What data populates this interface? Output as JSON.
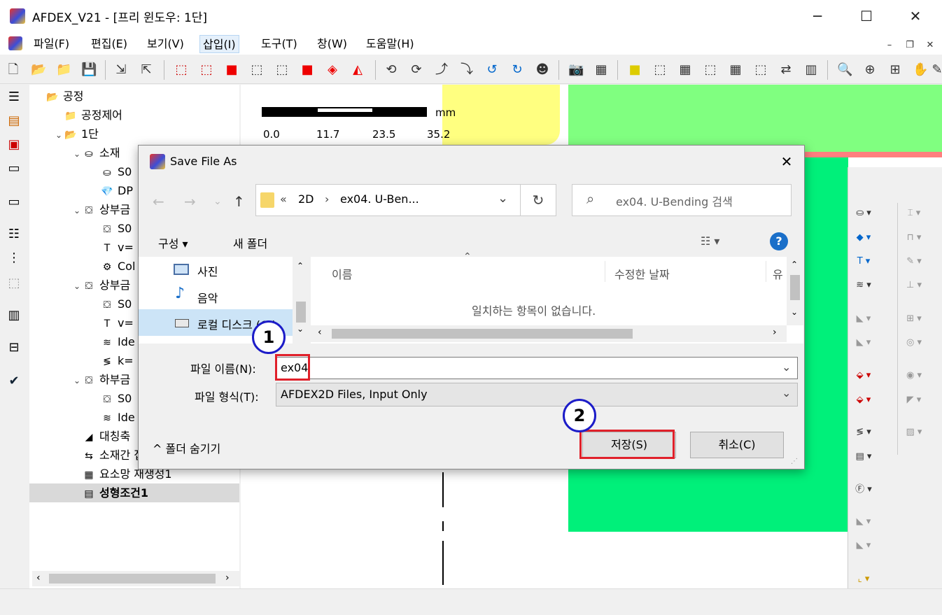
{
  "window": {
    "title": "AFDEX_V21 - [프리 윈도우: 1단]",
    "minimize": "─",
    "maximize": "☐",
    "close": "✕"
  },
  "menu": {
    "items": [
      "파일(F)",
      "편집(E)",
      "보기(V)",
      "삽입(I)",
      "도구(T)",
      "창(W)",
      "도움말(H)"
    ],
    "active_index": 3
  },
  "mdi": {
    "minimize": "–",
    "restore": "❐",
    "close": "✕"
  },
  "tree": [
    {
      "label": "공정",
      "depth": 0,
      "expand": "",
      "icon": "📂"
    },
    {
      "label": "공정제어",
      "depth": 1,
      "expand": "",
      "icon": "📁"
    },
    {
      "label": "1단",
      "depth": 1,
      "expand": "⌄",
      "icon": "📂"
    },
    {
      "label": "소재",
      "depth": 2,
      "expand": "⌄",
      "icon": "⛀"
    },
    {
      "label": "S0",
      "depth": 3,
      "expand": "",
      "icon": "⛀"
    },
    {
      "label": "DP",
      "depth": 3,
      "expand": "",
      "icon": "💎"
    },
    {
      "label": "상부금",
      "depth": 2,
      "expand": "⌄",
      "icon": "⛋"
    },
    {
      "label": "S0",
      "depth": 3,
      "expand": "",
      "icon": "⛋"
    },
    {
      "label": "v=",
      "depth": 3,
      "expand": "",
      "icon": "T"
    },
    {
      "label": "Col",
      "depth": 3,
      "expand": "",
      "icon": "⚙"
    },
    {
      "label": "상부금",
      "depth": 2,
      "expand": "⌄",
      "icon": "⛋"
    },
    {
      "label": "S0",
      "depth": 3,
      "expand": "",
      "icon": "⛋"
    },
    {
      "label": "v=",
      "depth": 3,
      "expand": "",
      "icon": "T"
    },
    {
      "label": "Ide",
      "depth": 3,
      "expand": "",
      "icon": "≋"
    },
    {
      "label": "k=",
      "depth": 3,
      "expand": "",
      "icon": "≶"
    },
    {
      "label": "하부금",
      "depth": 2,
      "expand": "⌄",
      "icon": "⛋"
    },
    {
      "label": "S0",
      "depth": 3,
      "expand": "",
      "icon": "⛋"
    },
    {
      "label": "Ide",
      "depth": 3,
      "expand": "",
      "icon": "≋"
    },
    {
      "label": "대칭축",
      "depth": 2,
      "expand": "",
      "icon": "◢"
    },
    {
      "label": "소재간 접촉",
      "depth": 2,
      "expand": "",
      "icon": "⇆"
    },
    {
      "label": "요소망 재생성1",
      "depth": 2,
      "expand": "",
      "icon": "▦"
    },
    {
      "label": "성형조건1",
      "depth": 2,
      "expand": "",
      "icon": "▤",
      "bold": true,
      "selected": true
    }
  ],
  "scale": {
    "unit": "mm",
    "ticks": [
      "0.0",
      "11.7",
      "23.5",
      "35.2"
    ]
  },
  "dialog": {
    "title": "Save File As",
    "close": "✕",
    "nav": {
      "back": "←",
      "forward": "→",
      "dropdown": "⌄",
      "up": "↑"
    },
    "address": {
      "prefix": "«",
      "parts": [
        "2D",
        "ex04. U-Ben..."
      ],
      "sep": "›",
      "dropdown": "⌄"
    },
    "refresh": "↻",
    "search": {
      "placeholder": "ex04. U-Bending 검색",
      "icon": "⌕"
    },
    "commands": {
      "organize": "구성 ▾",
      "new_folder": "새 폴더",
      "view": "☷ ▾",
      "help": "?"
    },
    "nav_pane": {
      "items": [
        "사진",
        "음악",
        "로컬 디스크 (C:)"
      ]
    },
    "columns": {
      "name": "이름",
      "modified": "수정한 날짜",
      "type": "유"
    },
    "empty_message": "일치하는 항목이 없습니다.",
    "filename_label": "파일 이름(N):",
    "filename_value": "ex04",
    "filetype_label": "파일 형식(T):",
    "filetype_value": "AFDEX2D Files, Input Only",
    "hide_folders": "^  폴더 숨기기",
    "save_button": "저장(S)",
    "cancel_button": "취소(C)"
  },
  "callouts": {
    "one": "1",
    "two": "2"
  },
  "colors": {
    "highlight": "#e0202a",
    "callout": "#1c1cc8",
    "green": "#00f07a",
    "light_green": "#80ff80",
    "yellow": "#ffff80"
  }
}
